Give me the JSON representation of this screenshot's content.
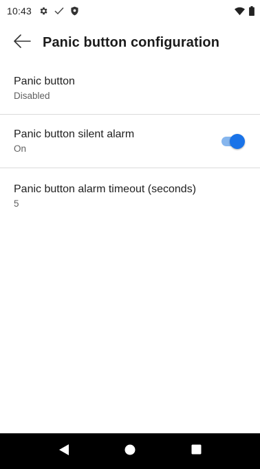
{
  "status_bar": {
    "time": "10:43",
    "left_icons": [
      "settings-gear-icon",
      "check-icon",
      "shield-icon"
    ],
    "right_icons": [
      "wifi-icon",
      "battery-icon"
    ]
  },
  "app_bar": {
    "back_icon": "arrow-left-icon",
    "title": "Panic button configuration"
  },
  "settings": [
    {
      "title": "Panic button",
      "summary": "Disabled"
    },
    {
      "title": "Panic button silent alarm",
      "summary": "On",
      "toggle": true
    },
    {
      "title": "Panic button alarm timeout (seconds)",
      "summary": "5"
    }
  ],
  "nav_bar": {
    "buttons": [
      "back-triangle-icon",
      "home-circle-icon",
      "recents-square-icon"
    ]
  },
  "colors": {
    "accent": "#1a73e8",
    "accent_track": "#86b6ee",
    "nav_background": "#000000",
    "divider": "#dadada"
  }
}
